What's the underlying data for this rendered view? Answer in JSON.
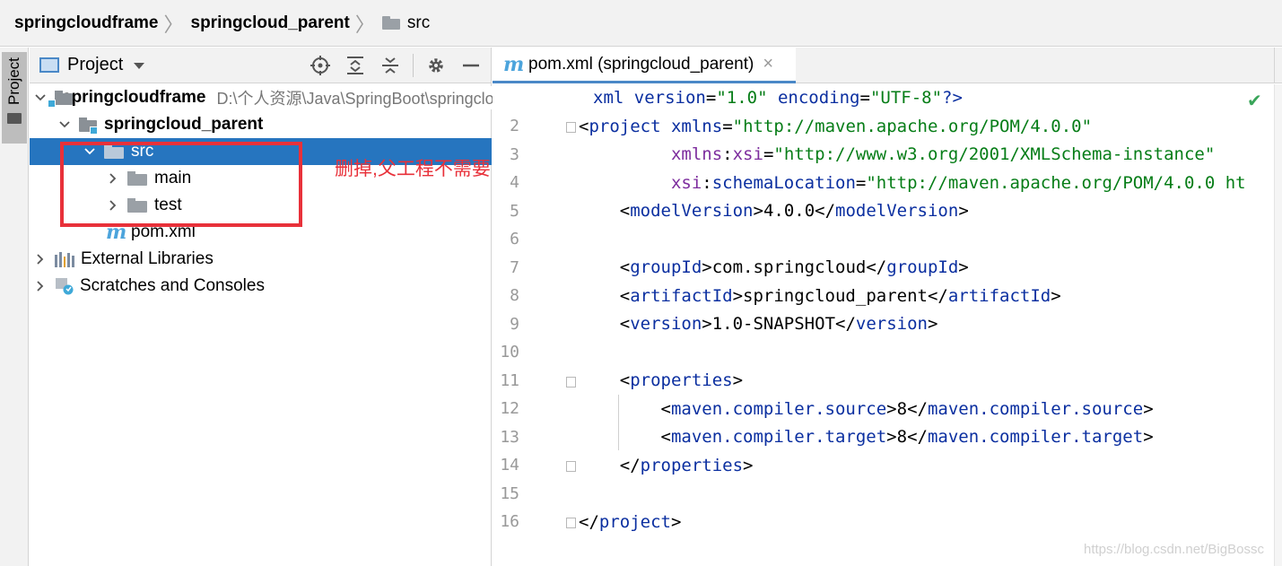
{
  "breadcrumb": {
    "items": [
      "springcloudframe",
      "springcloud_parent",
      "src"
    ]
  },
  "tool_stripe": {
    "label": "Project"
  },
  "project_panel": {
    "title": "Project",
    "tools": [
      "locate-icon",
      "expand-all-icon",
      "collapse-all-icon",
      "gear-icon",
      "minimize-icon"
    ],
    "tree": {
      "root": {
        "label": "springcloudframe",
        "path": "D:\\个人资源\\Java\\SpringBoot\\springcloudframe"
      },
      "parent": {
        "label": "springcloud_parent"
      },
      "src": {
        "label": "src"
      },
      "main": {
        "label": "main"
      },
      "test": {
        "label": "test"
      },
      "pom": {
        "label": "pom.xml"
      },
      "external": {
        "label": "External Libraries"
      },
      "scratches": {
        "label": "Scratches and Consoles"
      }
    }
  },
  "annotation": {
    "text": "删掉,父工程不需要",
    "color": "#e8313a"
  },
  "editor": {
    "tab": {
      "icon": "m",
      "label": "pom.xml (springcloud_parent)",
      "close": "×"
    },
    "line_numbers": [
      "2",
      "3",
      "4",
      "5",
      "6",
      "7",
      "8",
      "9",
      "10",
      "11",
      "12",
      "13",
      "14",
      "15",
      "16"
    ],
    "code": {
      "l1_decl": "xml",
      "l1_version_attr": "version",
      "l1_version_val": "\"1.0\"",
      "l1_encoding_attr": "encoding",
      "l1_encoding_val": "\"UTF-8\"",
      "l1_end": "?>",
      "l2_tag": "project",
      "l2_attr": "xmlns",
      "l2_val": "\"http://maven.apache.org/POM/4.0.0\"",
      "l3_ns": "xmlns",
      "l3_attr": "xsi",
      "l3_val": "\"http://www.w3.org/2001/XMLSchema-instance\"",
      "l4_ns": "xsi",
      "l4_attr": "schemaLocation",
      "l4_val": "\"http://maven.apache.org/POM/4.0.0 ht",
      "l5_tag": "modelVersion",
      "l5_val": "4.0.0",
      "l7_tag": "groupId",
      "l7_val": "com.springcloud",
      "l8_tag": "artifactId",
      "l8_val": "springcloud_parent",
      "l9_tag": "version",
      "l9_val": "1.0-SNAPSHOT",
      "l11_tag": "properties",
      "l12_tag": "maven.compiler.source",
      "l12_val": "8",
      "l13_tag": "maven.compiler.target",
      "l13_val": "8",
      "l14_tag": "properties",
      "l16_tag": "project"
    },
    "status_check": "✔"
  },
  "watermark": "https://blog.csdn.net/BigBossc"
}
